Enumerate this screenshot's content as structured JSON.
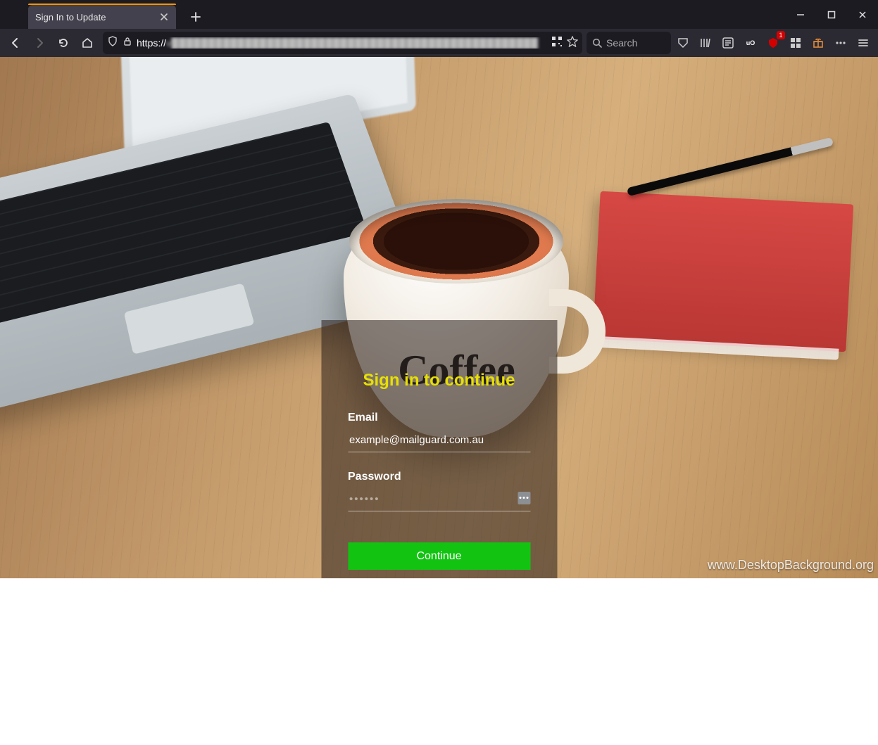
{
  "browser": {
    "tab_title": "Sign In to Update",
    "url_protocol": "https://",
    "url_rest": "v██████████████████████████████████████████████████",
    "search_placeholder": "Search",
    "badge_count": "1"
  },
  "page": {
    "mug_text": "Coffee",
    "watermark": "www.DesktopBackground.org"
  },
  "login": {
    "title": "Sign in to continue",
    "email_label": "Email",
    "email_value": "example@mailguard.com.au",
    "password_label": "Password",
    "password_placeholder": "••••••",
    "continue_label": "Continue"
  }
}
